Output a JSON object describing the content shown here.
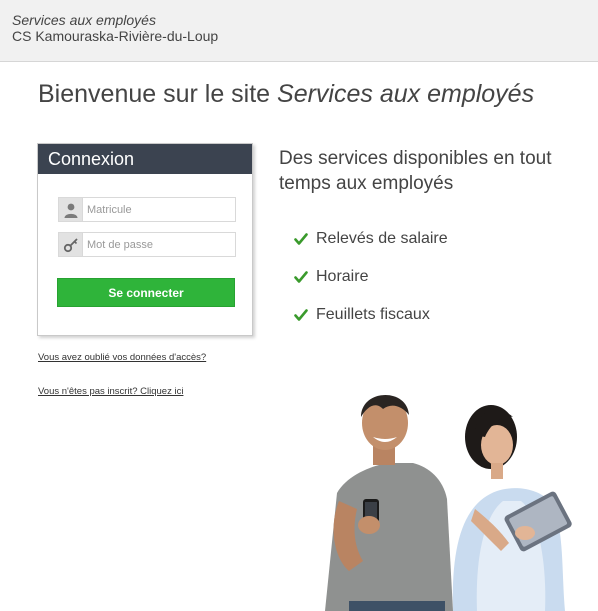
{
  "header": {
    "title": "Services aux employés",
    "subtitle": "CS Kamouraska-Rivière-du-Loup"
  },
  "welcome": {
    "prefix": "Bienvenue sur le site ",
    "emphasis": "Services aux employés"
  },
  "login": {
    "title": "Connexion",
    "username_placeholder": "Matricule",
    "username_value": "",
    "password_placeholder": "Mot de passe",
    "password_value": "",
    "submit_label": "Se connecter",
    "username_icon": "user-icon",
    "password_icon": "key-icon"
  },
  "links": {
    "forgot": "Vous avez oublié vos données d'accès?",
    "register": "Vous n'êtes pas inscrit? Cliquez ici"
  },
  "services": {
    "title": "Des services disponibles en tout temps aux employés",
    "items": [
      {
        "label": "Relevés de salaire",
        "icon": "checkmark-icon"
      },
      {
        "label": "Horaire",
        "icon": "checkmark-icon"
      },
      {
        "label": "Feuillets fiscaux",
        "icon": "checkmark-icon"
      }
    ]
  },
  "colors": {
    "header_bg": "#f1f1f1",
    "login_header_bg": "#3b4350",
    "button_green": "#2fb43a",
    "check_green": "#3a9a2c"
  }
}
